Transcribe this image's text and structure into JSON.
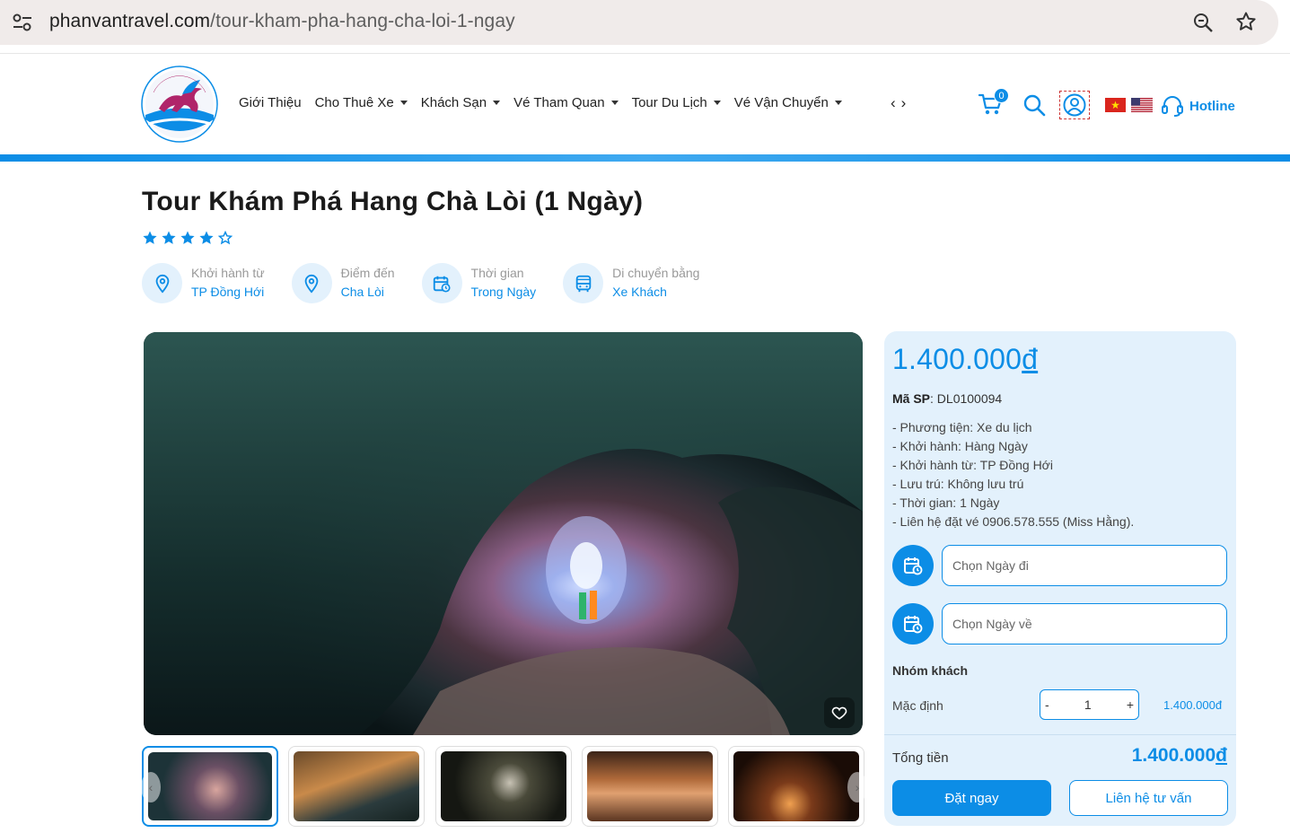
{
  "browser": {
    "url_host": "phanvantravel.com",
    "url_path": "/tour-kham-pha-hang-cha-loi-1-ngay"
  },
  "header": {
    "logo_text": "CÔNG TY TNHH PHAN VĂN",
    "nav": [
      {
        "label": "Giới Thiệu",
        "has_dropdown": false
      },
      {
        "label": "Cho Thuê Xe",
        "has_dropdown": true
      },
      {
        "label": "Khách Sạn",
        "has_dropdown": true
      },
      {
        "label": "Vé Tham Quan",
        "has_dropdown": true
      },
      {
        "label": "Tour Du Lịch",
        "has_dropdown": true
      },
      {
        "label": "Vé Vận Chuyển",
        "has_dropdown": true
      }
    ],
    "cart_count": "0",
    "hotline_label": "Hotline"
  },
  "tour": {
    "title": "Tour Khám Phá Hang Chà Lòi (1 Ngày)",
    "rating": 4,
    "rating_max": 5,
    "info": [
      {
        "label": "Khởi hành từ",
        "value": "TP Đồng Hới",
        "icon": "map-pin-icon"
      },
      {
        "label": "Điểm đến",
        "value": "Cha Lòi",
        "icon": "map-pin-icon"
      },
      {
        "label": "Thời gian",
        "value": "Trong Ngày",
        "icon": "calendar-clock-icon"
      },
      {
        "label": "Di chuyển bằng",
        "value": "Xe Khách",
        "icon": "bus-icon"
      }
    ]
  },
  "booking": {
    "price": "1.400.000",
    "currency": "đ",
    "sku_label": "Mã SP",
    "sku_value": ": DL0100094",
    "details": [
      "- Phương tiện: Xe du lịch",
      "- Khởi hành: Hàng Ngày",
      "- Khởi hành từ: TP Đồng Hới",
      "- Lưu trú: Không lưu trú",
      "- Thời gian: 1 Ngày",
      "- Liên hệ đặt vé 0906.578.555 (Miss Hằng)."
    ],
    "depart_placeholder": "Chọn Ngày đi",
    "return_placeholder": "Chọn Ngày về",
    "group_title": "Nhóm khách",
    "default_label": "Mặc định",
    "qty_minus": "-",
    "qty_value": "1",
    "qty_plus": "+",
    "line_price": "1.400.000đ",
    "total_label": "Tổng tiền",
    "total_value": "1.400.000",
    "book_label": "Đặt ngay",
    "contact_label": "Liên hệ tư vấn"
  },
  "colors": {
    "brand_blue": "#0c8de6",
    "panel_bg": "#e3f1fc"
  }
}
